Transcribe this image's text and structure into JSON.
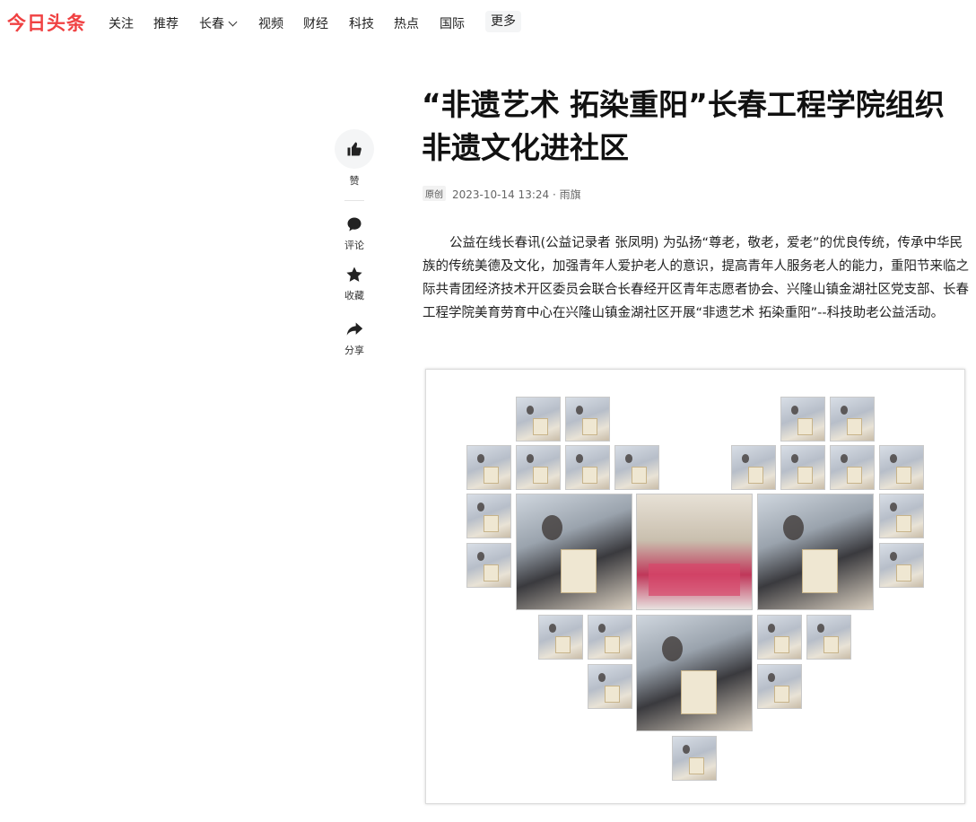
{
  "header": {
    "logo": "今日头条",
    "nav": [
      "关注",
      "推荐",
      "长春",
      "视频",
      "财经",
      "科技",
      "热点",
      "国际"
    ],
    "more": "更多"
  },
  "side_actions": {
    "like": "赞",
    "comment": "评论",
    "collect": "收藏",
    "share": "分享"
  },
  "article": {
    "title": "“非遗艺术 拓染重阳”长春工程学院组织非遗文化进社区",
    "badge": "原创",
    "meta": "2023-10-14 13:24 · 雨旗",
    "body": "公益在线长春讯(公益记录者 张凤明) 为弘扬“尊老，敬老，爱老”的优良传统，传承中华民族的传统美德及文化，加强青年人爱护老人的意识，提高青年人服务老人的能力，重阳节来临之际共青团经济技术开区委员会联合长春经开区青年志愿者协会、兴隆山镇金湖社区党支部、长春工程学院美育劳育中心在兴隆山镇金湖社区开展“非遗艺术 拓染重阳”--科技助老公益活动。"
  },
  "colors": {
    "brand": "#f04142"
  }
}
